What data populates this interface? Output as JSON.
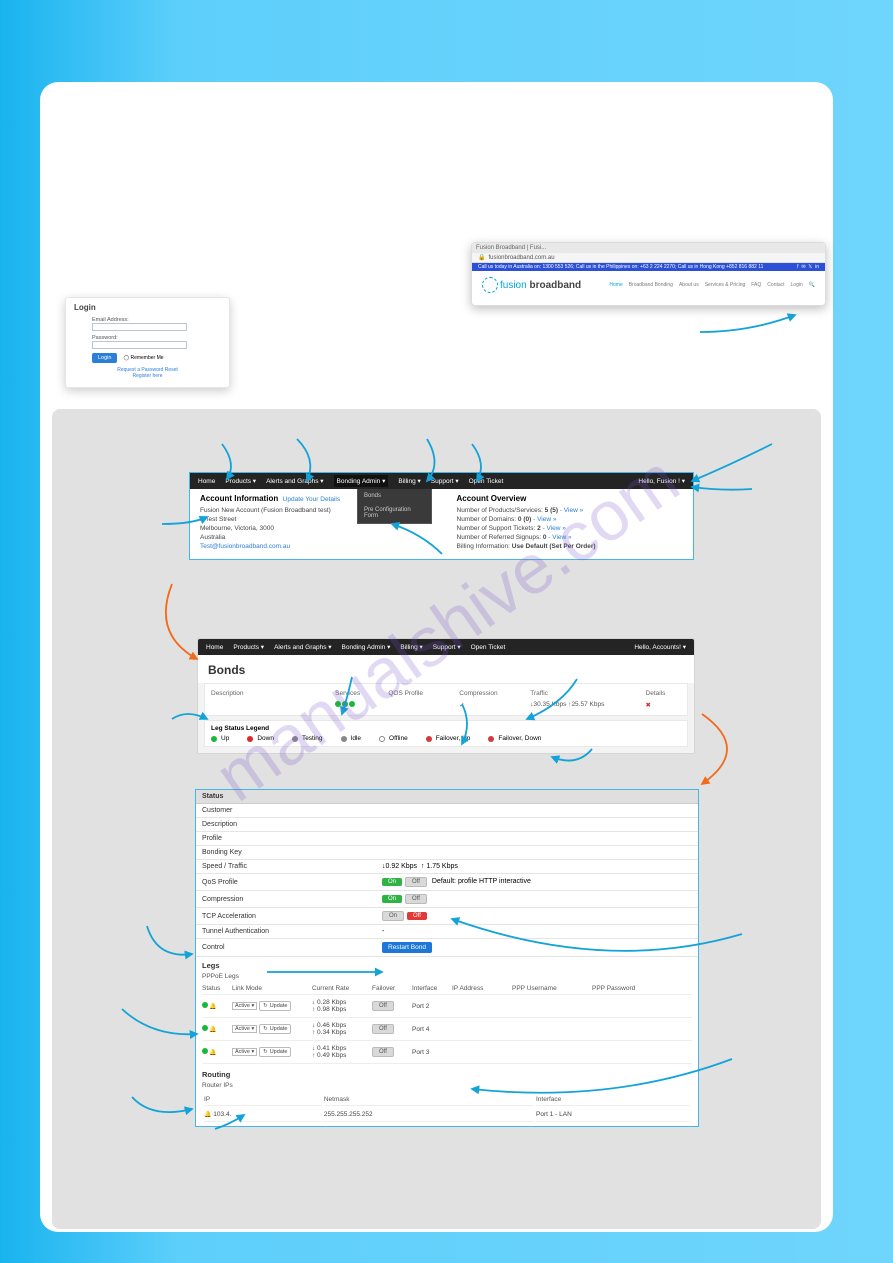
{
  "watermark": "manualshive.com",
  "browser": {
    "tab": "Fusion Broadband | Fusi...",
    "url": "fusionbroadband.com.au",
    "bluebar_left": "Call us today in Australia on: 1300 553 526; Call us in the Philippines on: +63 2 224 2270; Call us in Hong Kong +852 816 882 11",
    "logo_a": "fusion",
    "logo_b": "broadband",
    "nav": [
      "Home",
      "Broadband Bonding",
      "About us",
      "Services & Pricing",
      "FAQ",
      "Contact",
      "Login",
      "🔍"
    ]
  },
  "login": {
    "title": "Login",
    "email_lbl": "Email Address:",
    "pass_lbl": "Password:",
    "btn": "Login",
    "remember": "Remember Me",
    "reset": "Request a Password Reset",
    "register": "Register here"
  },
  "nav1": {
    "items": [
      "Home",
      "Products ▾",
      "Alerts and Graphs ▾",
      "Bonding Admin ▾",
      "Billing ▾",
      "Support ▾",
      "Open Ticket"
    ],
    "right": "Hello, Fusion ! ▾",
    "submenu": [
      "Bonds",
      "Pre Configuration Form"
    ]
  },
  "acct": {
    "left_title": "Account Information",
    "update": "Update Your Details",
    "l1": "Fusion New Account (Fusion Broadband test)",
    "l2": "1 Test Street",
    "l3": "Melbourne, Victoria, 3000",
    "l4": "Australia",
    "l5": "Test@fusionbroadband.com.au",
    "right_title": "Account Overview",
    "r1a": "Number of Products/Services: ",
    "r1b": "5 (5)",
    "r1c": " - View »",
    "r2a": "Number of Domains: ",
    "r2b": "0 (0)",
    "r2c": " - View »",
    "r3a": "Number of Support Tickets: ",
    "r3b": "2",
    "r3c": " - View »",
    "r4a": "Number of Referred Signups: ",
    "r4b": "0",
    "r4c": " - View »",
    "r5a": "Billing Information: ",
    "r5b": "Use Default (Set Per Order)"
  },
  "nav2": {
    "items": [
      "Home",
      "Products ▾",
      "Alerts and Graphs ▾",
      "Bonding Admin ▾",
      "Billing ▾",
      "Support ▾",
      "Open Ticket"
    ],
    "right": "Hello, Accounts! ▾"
  },
  "bonds": {
    "title": "Bonds",
    "cols": [
      "Description",
      "Services",
      "QOS Profile",
      "Compression",
      "Traffic",
      "Details"
    ],
    "traffic_dn": "↓30.35 Kbps",
    "traffic_up": "↑25.57 Kbps",
    "details_icon": "✖",
    "legend_title": "Leg Status Legend",
    "legend": [
      "Up",
      "Down",
      "Testing",
      "Idle",
      "Offline",
      "Failover, Up",
      "Failover, Down"
    ]
  },
  "status": {
    "title": "Status",
    "rows_plain": [
      "Customer",
      "Description",
      "Profile",
      "Bonding Key"
    ],
    "speed_lbl": "Speed / Traffic",
    "speed_dn": "↓0.92 Kbps",
    "speed_up": "↑ 1.75 Kbps",
    "qos_lbl": "QoS Profile",
    "qos_text": "Default: profile HTTP interactive",
    "comp_lbl": "Compression",
    "tcp_lbl": "TCP Acceleration",
    "tun_lbl": "Tunnel Authentication",
    "tun_val": "-",
    "ctrl_lbl": "Control",
    "ctrl_btn": "Restart Bond",
    "on": "On",
    "off": "Off"
  },
  "legs": {
    "title": "Legs",
    "sub": "PPPoE Legs",
    "cols": [
      "Status",
      "Link Mode",
      "Current Rate",
      "Failover",
      "Interface",
      "IP Address",
      "PPP Username",
      "PPP Password"
    ],
    "linkmode": "Active",
    "update": "Update",
    "failover_off": "Off",
    "rows": [
      {
        "dn": "↓ 0.28 Kbps",
        "up": "↑ 0.98 Kbps",
        "iface": "Port 2"
      },
      {
        "dn": "↓ 0.46 Kbps",
        "up": "↑ 0.34 Kbps",
        "iface": "Port 4"
      },
      {
        "dn": "↓ 0.41 Kbps",
        "up": "↑ 0.49 Kbps",
        "iface": "Port 3"
      }
    ]
  },
  "routing": {
    "title": "Routing",
    "sub": "Router IPs",
    "cols": [
      "IP",
      "Netmask",
      "Interface"
    ],
    "ip": "103.4.",
    "mask": "255.255.255.252",
    "iface": "Port 1 - LAN"
  }
}
